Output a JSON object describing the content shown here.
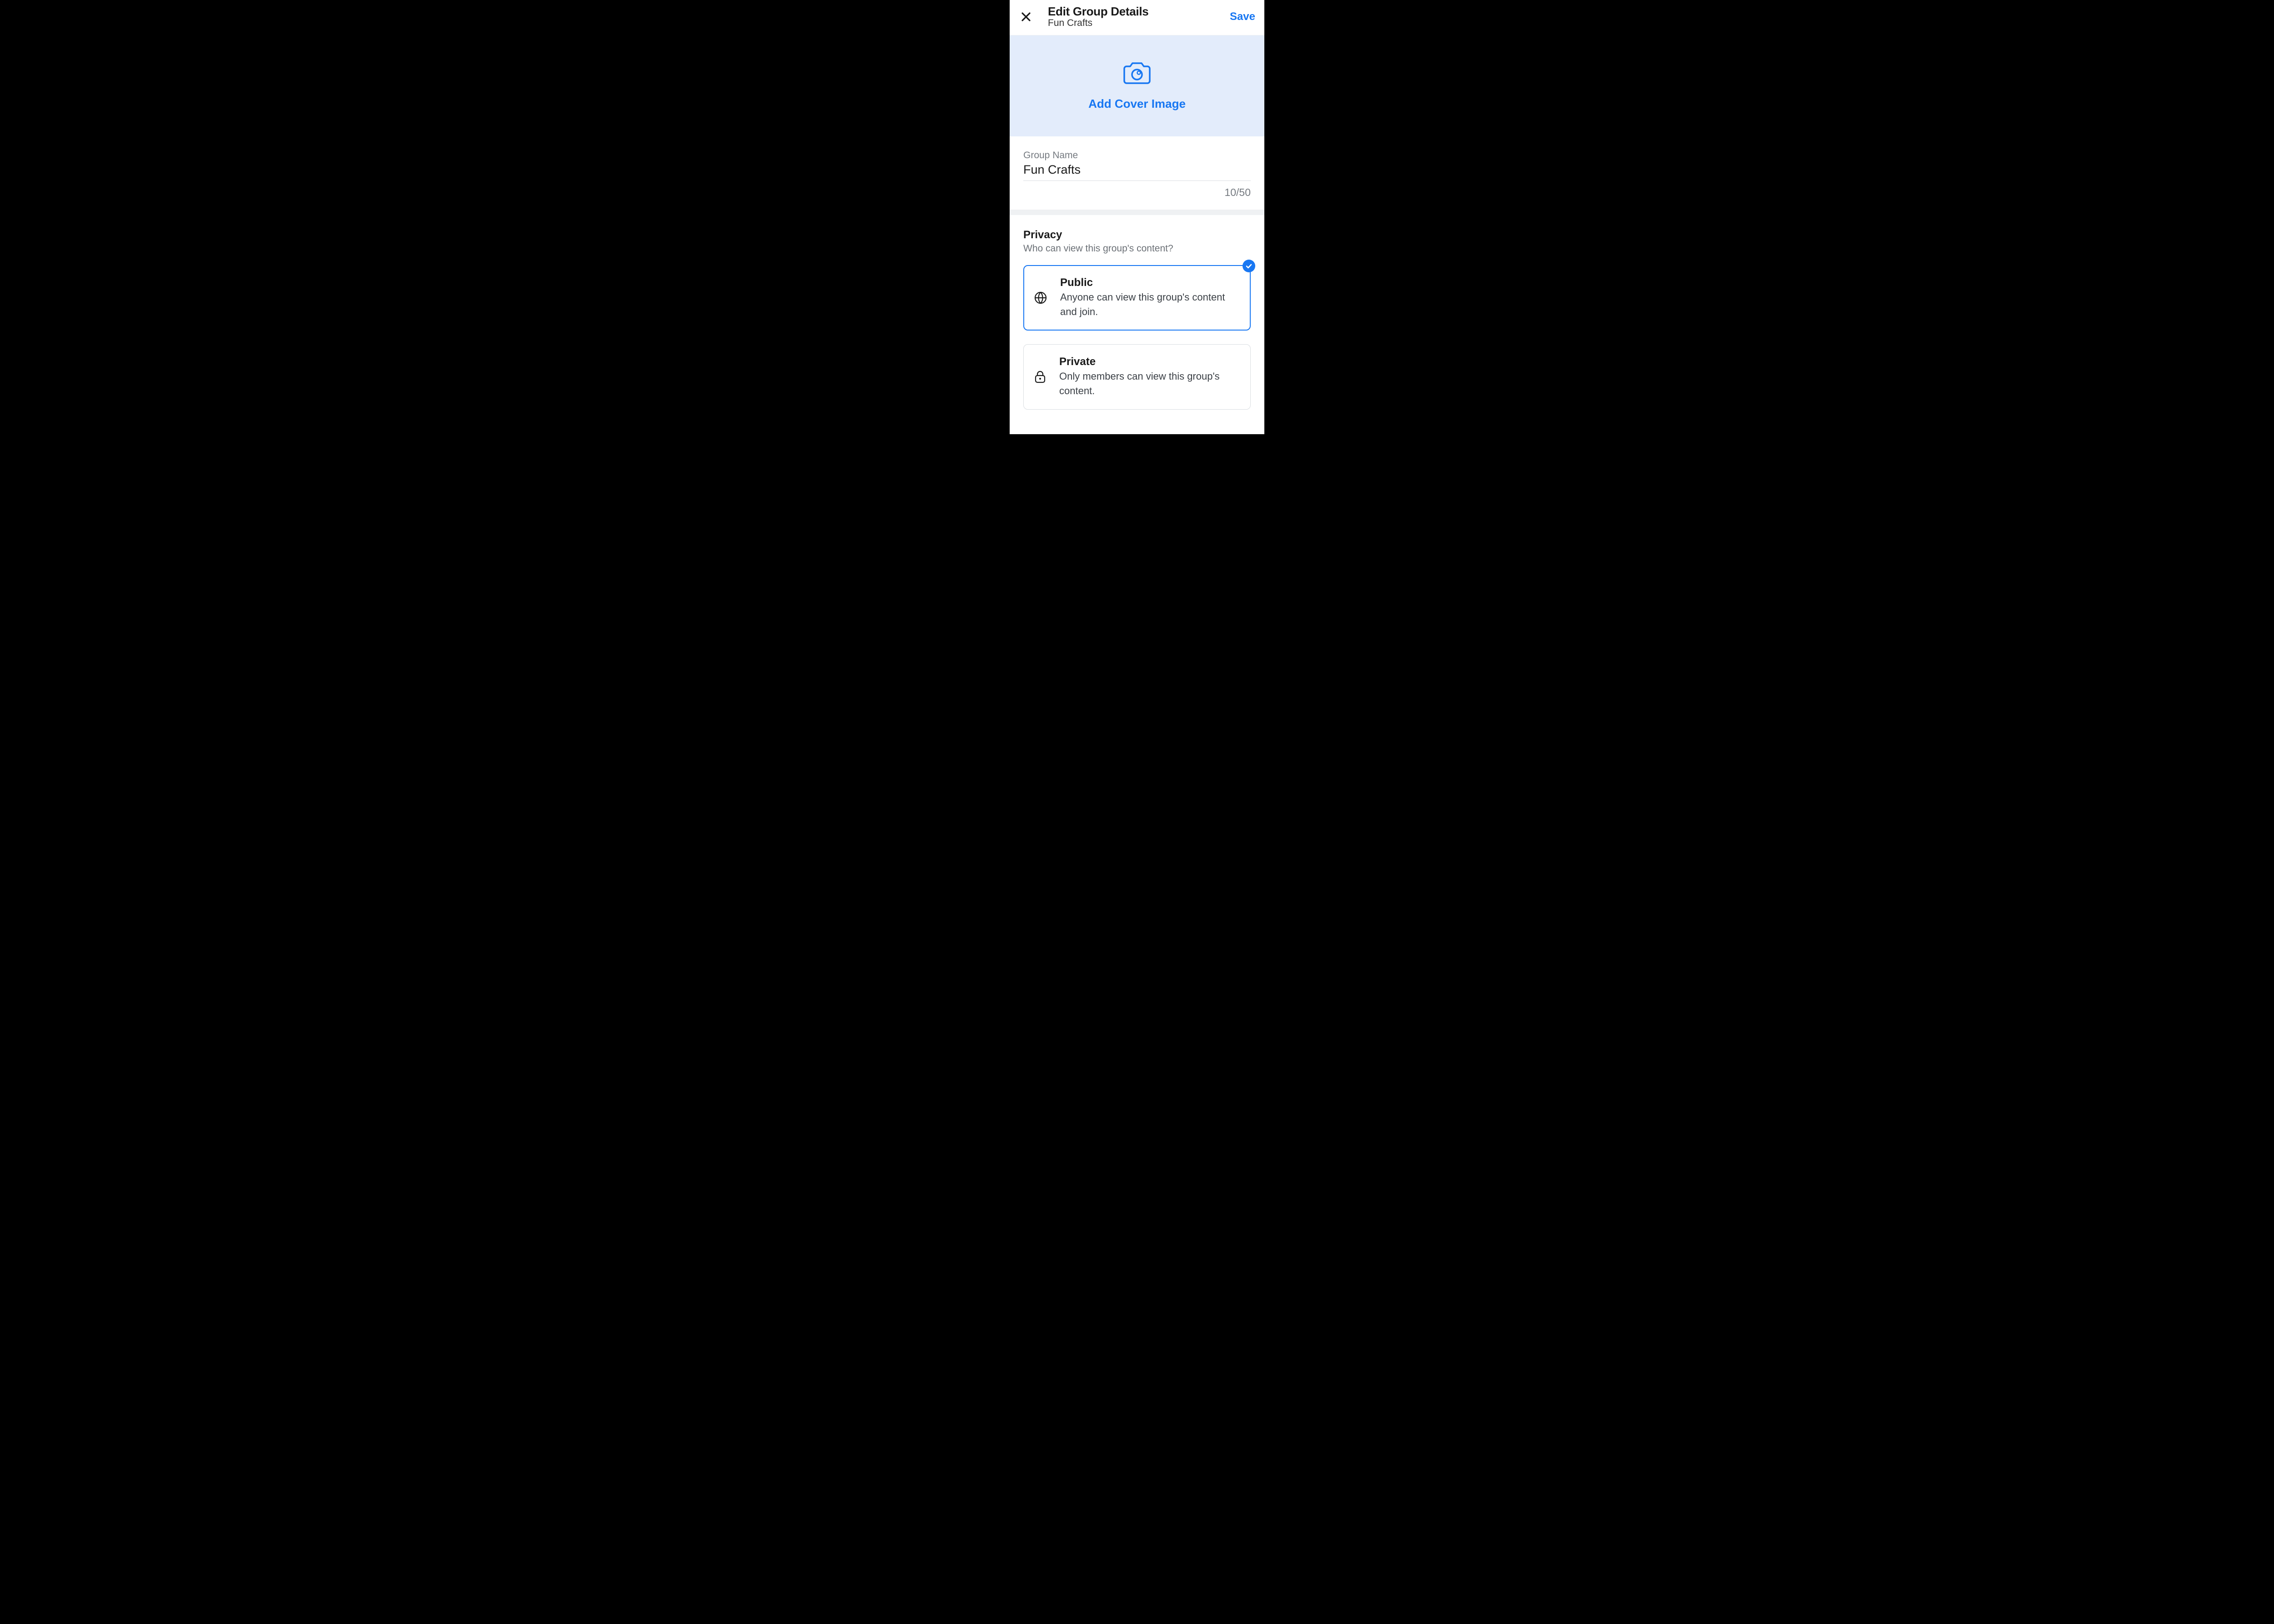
{
  "header": {
    "title": "Edit Group Details",
    "subtitle": "Fun Crafts",
    "save_label": "Save"
  },
  "cover": {
    "add_label": "Add Cover Image"
  },
  "name_field": {
    "label": "Group Name",
    "value": "Fun Crafts",
    "counter": "10/50"
  },
  "privacy": {
    "heading": "Privacy",
    "sub": "Who can view this group's content?",
    "options": [
      {
        "title": "Public",
        "desc": "Anyone can view this group's content and join.",
        "selected": true
      },
      {
        "title": "Private",
        "desc": "Only members can view this group's content.",
        "selected": false
      }
    ]
  },
  "colors": {
    "accent": "#1877f2"
  }
}
